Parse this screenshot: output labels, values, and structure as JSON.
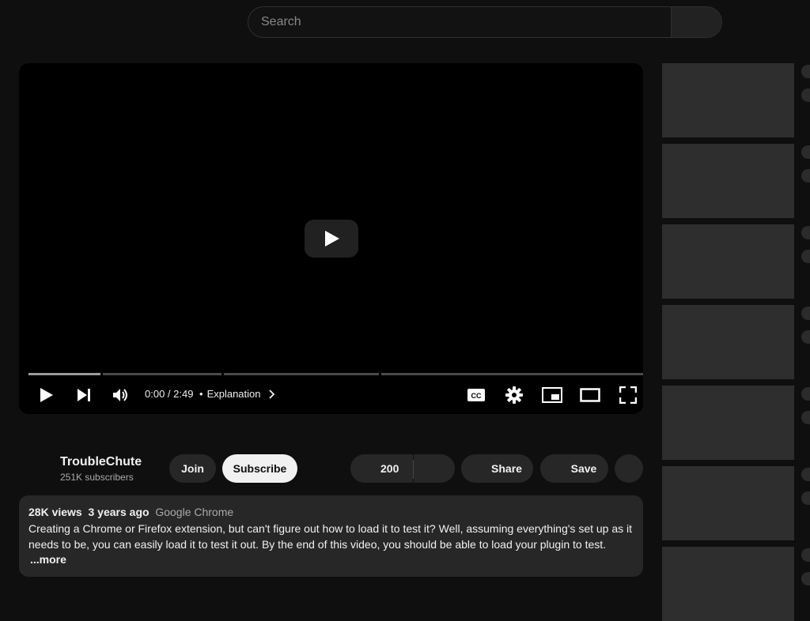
{
  "search": {
    "placeholder": "Search",
    "value": ""
  },
  "player": {
    "time": "0:00 / 2:49",
    "chapter_separator": "•",
    "chapter": "Explanation",
    "progress_fraction": 0
  },
  "channel": {
    "name": "TroubleChute",
    "subscribers": "251K subscribers",
    "join_label": "Join",
    "subscribe_label": "Subscribe"
  },
  "actions": {
    "like_count": "200",
    "share_label": "Share",
    "save_label": "Save"
  },
  "description": {
    "views": "28K views",
    "age": "3 years ago",
    "tag": "Google Chrome",
    "text": "Creating a Chrome or Firefox extension, but can't figure out how to load it to test it? Well, assuming everything's set up as it needs to be, you can easily load it to test it out. By the end of this video, you should be able to load your plugin to test.",
    "more_label": "...more"
  },
  "icons": {
    "play": "play-icon",
    "next": "next-icon",
    "volume": "volume-icon",
    "captions": "cc-icon",
    "settings": "gear-icon",
    "miniplayer": "miniplayer-icon",
    "theater": "theater-icon",
    "fullscreen": "fullscreen-icon"
  }
}
